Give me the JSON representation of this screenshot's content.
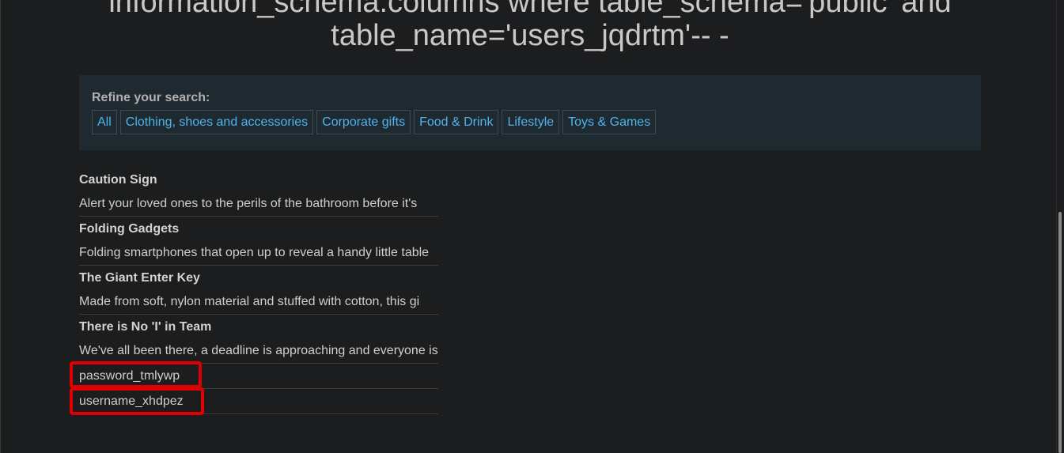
{
  "heading": {
    "line1": "information_schema.columns where table_schema='public' and",
    "line2": "table_name='users_jqdrtm'-- -"
  },
  "filters": {
    "title": "Refine your search:",
    "items": [
      {
        "label": "All"
      },
      {
        "label": "Clothing, shoes and accessories"
      },
      {
        "label": "Corporate gifts"
      },
      {
        "label": "Food & Drink"
      },
      {
        "label": "Lifestyle"
      },
      {
        "label": "Toys & Games"
      }
    ]
  },
  "products": [
    {
      "name": "Caution Sign",
      "description": "Alert your loved ones to the perils of the bathroom before it's"
    },
    {
      "name": "Folding Gadgets",
      "description": "Folding smartphones that open up to reveal a handy little table"
    },
    {
      "name": "The Giant Enter Key",
      "description": "Made from soft, nylon material and stuffed with cotton, this gi"
    },
    {
      "name": "There is No 'I' in Team",
      "description": "We've all been there, a deadline is approaching and everyone is"
    }
  ],
  "extra_rows": [
    {
      "text": "password_tmlywp"
    },
    {
      "text": "username_xhdpez"
    }
  ],
  "colors": {
    "background": "#1b1d1f",
    "link": "#4fb3f0",
    "highlight": "#e00000"
  }
}
